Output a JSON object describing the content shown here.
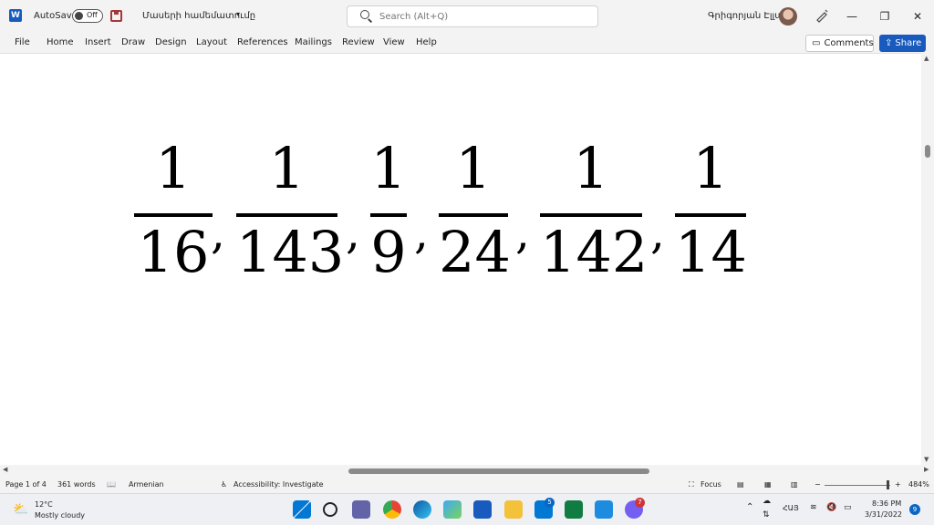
{
  "titlebar": {
    "app_logo": "W",
    "autosave_label": "AutoSave",
    "autosave_state": "Off",
    "doc_title": "Մասերի համեմատումը",
    "search_placeholder": "Search (Alt+Q)",
    "user_name": "Գրիգորյան Էլլա"
  },
  "menu": {
    "items": [
      "File",
      "Home",
      "Insert",
      "Draw",
      "Design",
      "Layout",
      "References",
      "Mailings",
      "Review",
      "View",
      "Help"
    ],
    "comments_label": "Comments",
    "share_label": "Share"
  },
  "document": {
    "fractions": [
      {
        "num": "1",
        "den": "16"
      },
      {
        "num": "1",
        "den": "143"
      },
      {
        "num": "1",
        "den": "9"
      },
      {
        "num": "1",
        "den": "24"
      },
      {
        "num": "1",
        "den": "142"
      },
      {
        "num": "1",
        "den": "14"
      }
    ],
    "separator": ","
  },
  "status": {
    "page": "Page 1 of 4",
    "words": "361 words",
    "language": "Armenian",
    "accessibility": "Accessibility: Investigate",
    "focus": "Focus",
    "zoom": "484%",
    "zoom_fraction": 0.96
  },
  "taskbar": {
    "weather_temp": "12°C",
    "weather_desc": "Mostly cloudy",
    "lang": "ՀԱՅ",
    "time": "8:36 PM",
    "date": "3/31/2022",
    "notifications": "9",
    "mail_badge": "5",
    "viber_badge": "7"
  },
  "colors": {
    "word_blue": "#185abd",
    "accent_red": "#a4373a",
    "excel_green": "#107c41"
  }
}
